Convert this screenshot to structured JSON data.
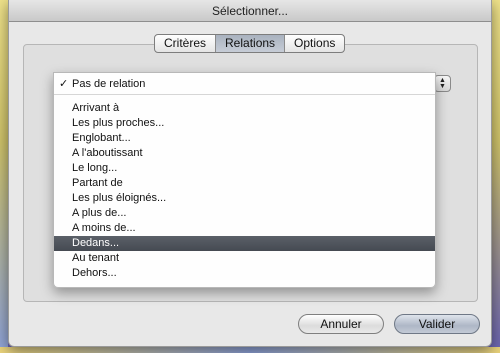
{
  "window": {
    "title": "Sélectionner..."
  },
  "tabs": [
    {
      "label": "Critères",
      "selected": false
    },
    {
      "label": "Relations",
      "selected": true
    },
    {
      "label": "Options",
      "selected": false
    }
  ],
  "menu": {
    "current": "Pas de relation",
    "items": [
      "Arrivant à",
      "Les plus proches...",
      "Englobant...",
      "A l'aboutissant",
      "Le long...",
      "Partant de",
      "Les plus éloignés...",
      "A plus de...",
      "A moins de...",
      "Dedans...",
      "Au tenant",
      "Dehors..."
    ],
    "highlighted": "Dedans..."
  },
  "buttons": {
    "cancel": "Annuler",
    "ok": "Valider"
  },
  "colors": {
    "highlight": "#4e535b",
    "window_bg": "#e8e8e8",
    "desktop": "#5b54a8"
  }
}
